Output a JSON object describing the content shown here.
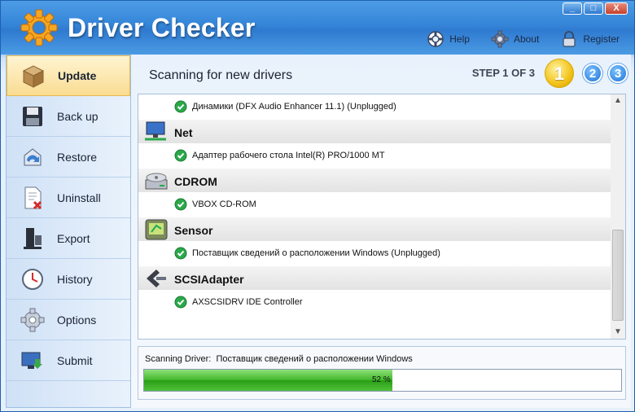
{
  "app": {
    "title": "Driver Checker"
  },
  "window_buttons": {
    "minimize": "_",
    "maximize": "□",
    "close": "X"
  },
  "top_links": [
    {
      "label": "Help",
      "icon": "lifebuoy-icon"
    },
    {
      "label": "About",
      "icon": "gear-icon"
    },
    {
      "label": "Register",
      "icon": "padlock-icon"
    }
  ],
  "sidebar": {
    "items": [
      {
        "label": "Update",
        "icon": "box-icon",
        "active": true
      },
      {
        "label": "Back up",
        "icon": "floppy-disk-icon"
      },
      {
        "label": "Restore",
        "icon": "restore-icon"
      },
      {
        "label": "Uninstall",
        "icon": "uninstall-document-icon"
      },
      {
        "label": "Export",
        "icon": "export-icon"
      },
      {
        "label": "History",
        "icon": "clock-icon"
      },
      {
        "label": "Options",
        "icon": "options-gear-icon"
      },
      {
        "label": "Submit",
        "icon": "monitor-upload-icon"
      }
    ]
  },
  "main": {
    "title": "Scanning for new drivers",
    "step_text": "STEP 1 OF 3",
    "steps": [
      "1",
      "2",
      "3"
    ]
  },
  "device_list": [
    {
      "kind": "device",
      "label": "Динамики (DFX Audio Enhancer 11.1) (Unplugged)"
    },
    {
      "kind": "category",
      "label": "Net",
      "icon": "network-icon"
    },
    {
      "kind": "device",
      "label": "Адаптер рабочего стола Intel(R) PRO/1000 MT"
    },
    {
      "kind": "category",
      "label": "CDROM",
      "icon": "cdrom-drive-icon"
    },
    {
      "kind": "device",
      "label": "VBOX CD-ROM"
    },
    {
      "kind": "category",
      "label": "Sensor",
      "icon": "sensor-icon"
    },
    {
      "kind": "device",
      "label": "Поставщик сведений о расположении Windows (Unplugged)"
    },
    {
      "kind": "category",
      "label": "SCSIAdapter",
      "icon": "scsi-adapter-icon"
    },
    {
      "kind": "device",
      "label": "AXSCSIDRV IDE Controller"
    }
  ],
  "status": {
    "prefix": "Scanning Driver:",
    "driver": "Поставщик сведений о расположении Windows",
    "progress_label": "52 %",
    "progress": 0.52
  },
  "colors": {
    "accent": "#3485d8",
    "active_nav": "#f9dc92",
    "progress_green": "#40b72a",
    "check_green": "#2aa84a"
  }
}
